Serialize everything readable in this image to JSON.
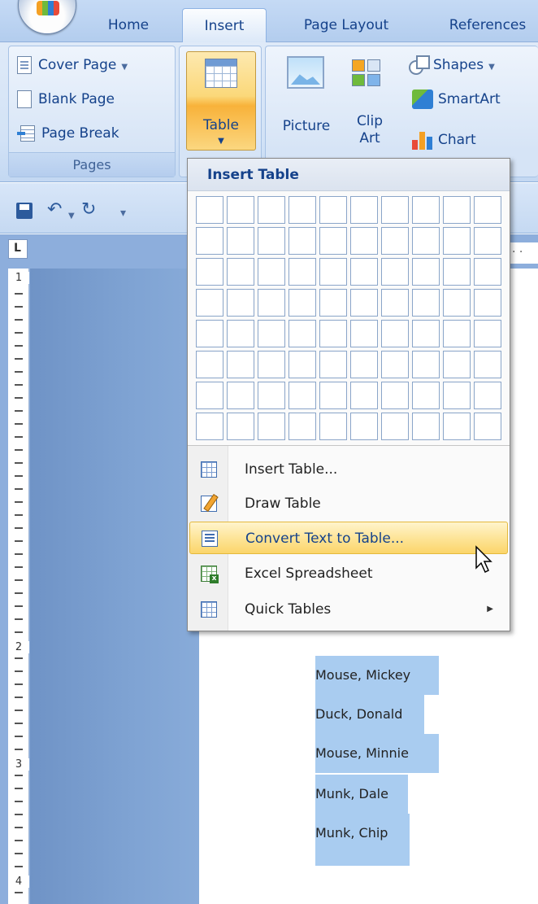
{
  "tabs": {
    "home": "Home",
    "insert": "Insert",
    "page_layout": "Page Layout",
    "references": "References"
  },
  "ribbon": {
    "pages": {
      "cover_page": "Cover Page",
      "blank_page": "Blank Page",
      "page_break": "Page Break",
      "label": "Pages"
    },
    "table_button": "Table",
    "picture": "Picture",
    "clip_art": "Clip Art",
    "shapes": "Shapes",
    "smartart": "SmartArt",
    "chart": "Chart"
  },
  "menu": {
    "header": "Insert Table",
    "grid": {
      "columns": 10,
      "rows": 8
    },
    "items": [
      {
        "label": "Insert Table...",
        "icon": "insert-table-icon"
      },
      {
        "label": "Draw Table",
        "icon": "draw-table-icon"
      },
      {
        "label": "Convert Text to Table...",
        "icon": "convert-text-icon",
        "highlighted": true
      },
      {
        "label": "Excel Spreadsheet",
        "icon": "excel-icon"
      },
      {
        "label": "Quick Tables",
        "icon": "quick-tables-icon",
        "submenu": true
      }
    ]
  },
  "ruler": {
    "marks": [
      "1",
      "2",
      "3",
      "4"
    ]
  },
  "document": {
    "lines": [
      "Mouse, Mickey",
      "Duck, Donald",
      "Mouse, Minnie",
      "Munk, Dale",
      "Munk, Chip"
    ]
  }
}
